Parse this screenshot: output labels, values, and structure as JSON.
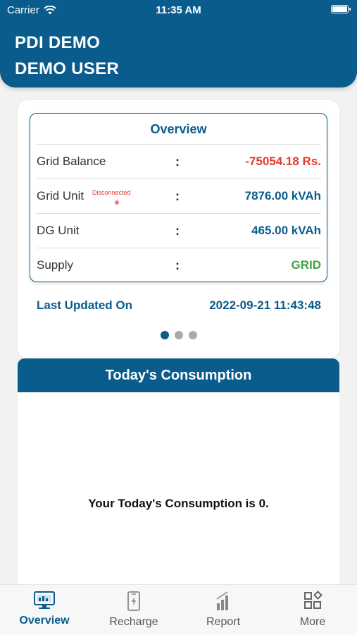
{
  "status_bar": {
    "carrier": "Carrier",
    "time": "11:35 AM"
  },
  "header": {
    "line1": "PDI DEMO",
    "line2": "DEMO USER"
  },
  "overview": {
    "title": "Overview",
    "rows": [
      {
        "label": "Grid Balance",
        "colon": ":",
        "value": "-75054.18 Rs.",
        "color": "#e53935"
      },
      {
        "label": "Grid Unit",
        "colon": ":",
        "value": "7876.00 kVAh",
        "color": "#0a5c8c",
        "badge": "Disconnected"
      },
      {
        "label": "DG Unit",
        "colon": ":",
        "value": "465.00 kVAh",
        "color": "#0a5c8c"
      },
      {
        "label": "Supply",
        "colon": ":",
        "value": "GRID",
        "color": "#43a047"
      }
    ],
    "last_updated_label": "Last Updated On",
    "last_updated_value": "2022-09-21 11:43:48",
    "pager": {
      "count": 3,
      "active_index": 0
    }
  },
  "consumption": {
    "title": "Today's Consumption",
    "message": "Your Today's Consumption is 0."
  },
  "tabs": [
    {
      "label": "Overview",
      "icon": "monitor-icon",
      "active": true
    },
    {
      "label": "Recharge",
      "icon": "phone-charge-icon",
      "active": false
    },
    {
      "label": "Report",
      "icon": "bar-chart-icon",
      "active": false
    },
    {
      "label": "More",
      "icon": "grid-shapes-icon",
      "active": false
    }
  ],
  "colors": {
    "primary": "#0a5c8c",
    "negative": "#e53935",
    "positive": "#43a047"
  }
}
